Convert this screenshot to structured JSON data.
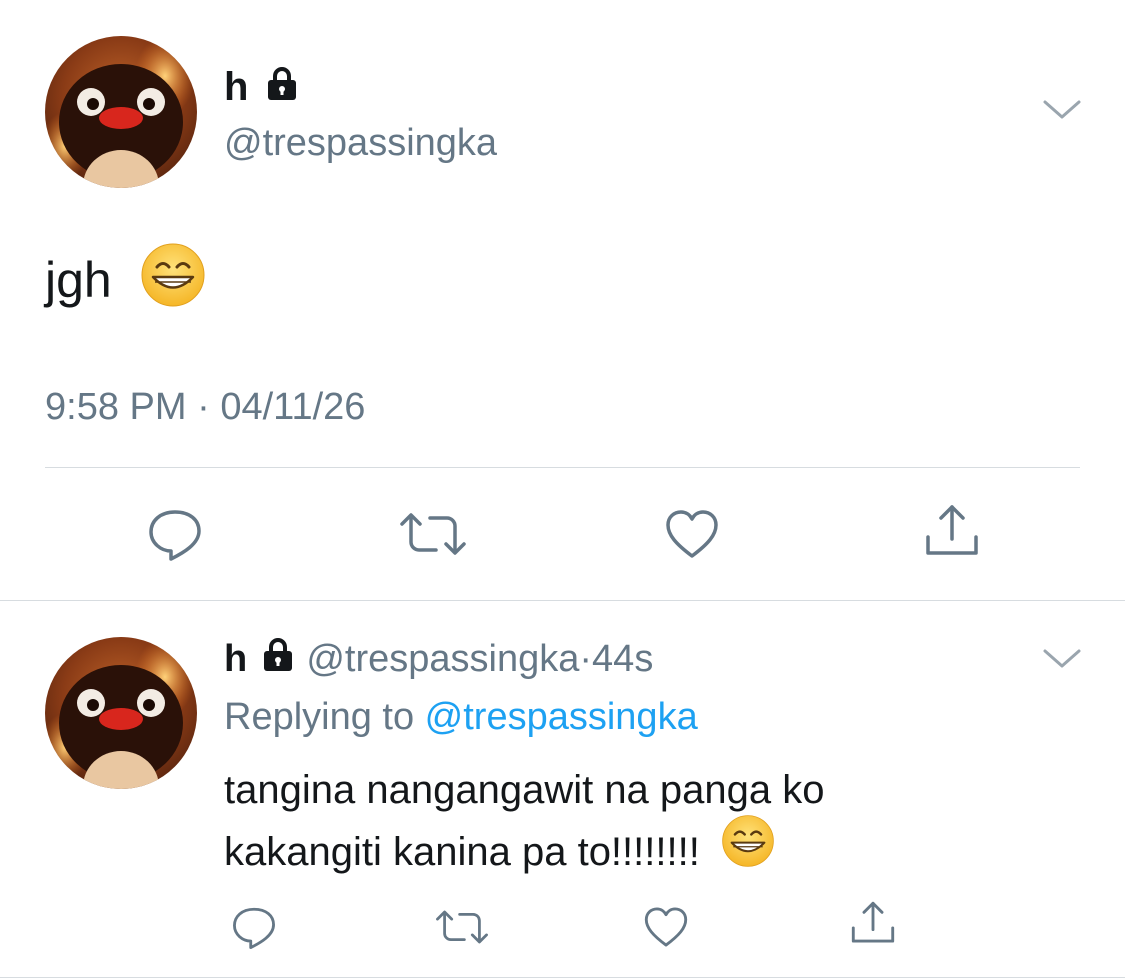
{
  "colors": {
    "text": "#14171a",
    "secondary": "#657786",
    "link": "#1da1f2",
    "divider": "#d7dce0"
  },
  "main_tweet": {
    "display_name": "h",
    "handle": "@trespassingka",
    "text": "jgh",
    "time": "9:58 PM",
    "separator": " · ",
    "date": "04/11/26",
    "actions": [
      "reply-icon",
      "retweet-icon",
      "like-icon",
      "share-icon"
    ]
  },
  "reply_tweet": {
    "display_name": "h",
    "handle": "@trespassingka",
    "separator": "·",
    "age": "44s",
    "replying_prefix": "Replying to ",
    "replying_to": "@trespassingka",
    "text_line1": "tangina nangangawit na panga ko",
    "text_line2": "kakangiti kanina pa to!!!!!!!!",
    "actions": [
      "reply-icon",
      "retweet-icon",
      "like-icon",
      "share-icon"
    ]
  }
}
